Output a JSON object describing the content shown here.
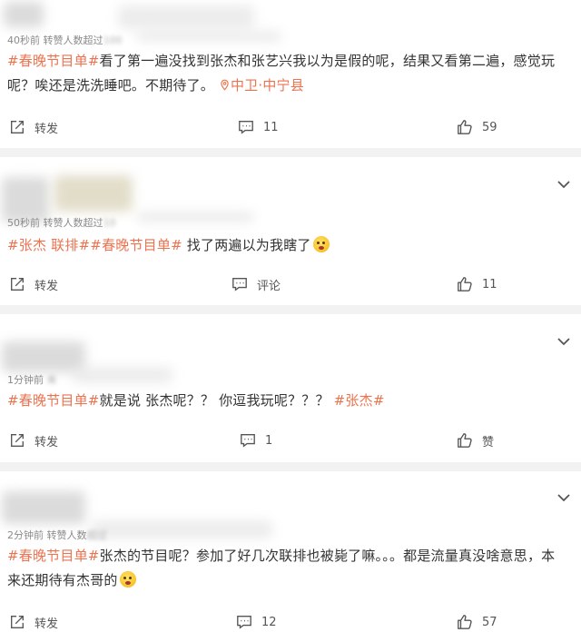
{
  "posts": [
    {
      "meta_visible": "40秒前  转赞人数超过",
      "meta_blurred": "100",
      "content": {
        "tag1": "#春晚节目单#",
        "text": "看了第一遍没找到张杰和张艺兴我以为是假的呢，结果又看第二遍，感觉玩呢？唉还是洗洗睡吧。不期待了。",
        "location": "中卫·中宁县"
      },
      "actions": {
        "repost": "转发",
        "comment": "11",
        "like": "59"
      }
    },
    {
      "meta_visible": "50秒前  转赞人数超过",
      "meta_blurred": "10",
      "content": {
        "tag1": "#张杰 联排##春晚节目单#",
        "text": " 找了两遍以为我瞎了"
      },
      "actions": {
        "repost": "转发",
        "comment": "评论",
        "like": "11"
      }
    },
    {
      "meta_visible": "1分钟前",
      "meta_blurred": "来",
      "content": {
        "tag1": "#春晚节目单#",
        "text": "就是说 张杰呢？？ 你逗我玩呢？？？ ",
        "tag2": "#张杰#"
      },
      "actions": {
        "repost": "转发",
        "comment": "1",
        "like": "赞"
      }
    },
    {
      "meta_visible": "2分钟前  转赞人数",
      "meta_blurred": "超过",
      "content": {
        "tag1": "#春晚节目单#",
        "text": "张杰的节目呢？参加了好几次联排也被毙了嘛。。。都是流量真没啥意思，本来还期待有杰哥的"
      },
      "actions": {
        "repost": "转发",
        "comment": "12",
        "like": "57"
      }
    }
  ],
  "icons": {
    "repost": "repost-icon",
    "comment": "comment-icon",
    "like": "thumbs-up-icon",
    "expand": "chevron-down-icon",
    "location": "location-pin-icon"
  },
  "colors": {
    "tag": "#eb7350",
    "background": "#f2f2f2",
    "card": "#ffffff"
  }
}
